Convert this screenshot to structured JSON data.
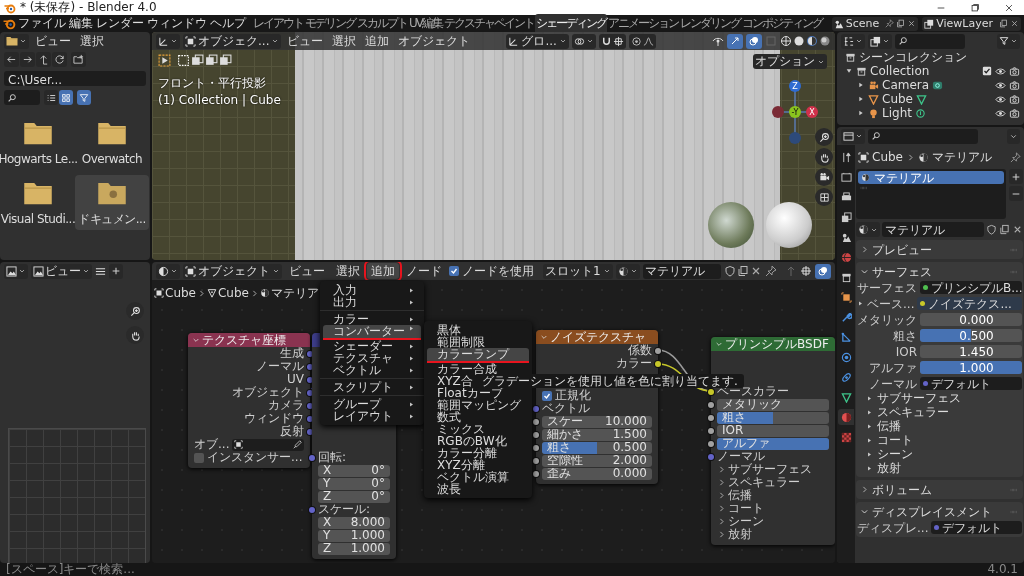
{
  "window": {
    "title": "* (未保存) - Blender 4.0"
  },
  "menu_bar": [
    "ファイル",
    "編集",
    "レンダー",
    "ウィンドウ",
    "ヘルプ"
  ],
  "workspace_tabs": [
    {
      "label": "レイアウト",
      "selected": false
    },
    {
      "label": "モデリング",
      "selected": false
    },
    {
      "label": "スカルプト",
      "selected": false
    },
    {
      "label": "UV編集",
      "selected": false
    },
    {
      "label": "テクスチャペイント",
      "selected": false
    },
    {
      "label": "シェーディング",
      "selected": true
    },
    {
      "label": "アニメーション",
      "selected": false
    },
    {
      "label": "レンダリング",
      "selected": false
    },
    {
      "label": "コンポジティング",
      "selected": false
    }
  ],
  "scene": "Scene",
  "view_layer": "ViewLayer",
  "file_browser": {
    "menu": [
      "ビュー",
      "選択"
    ],
    "path": "C:\\User...",
    "items": [
      {
        "name": "Hogwarts Le...",
        "selected": false
      },
      {
        "name": "Overwatch",
        "selected": false
      },
      {
        "name": "Visual Studi...",
        "selected": false
      },
      {
        "name": "ドキュメン...",
        "selected": true
      }
    ]
  },
  "viewport": {
    "mode": "オブジェク...",
    "menu": [
      "ビュー",
      "選択",
      "追加",
      "オブジェクト"
    ],
    "orientation": "グロ...",
    "options": "オプション",
    "view_name": "フロント・平行投影",
    "info": "(1) Collection | Cube",
    "gizmo": {
      "z": "Z",
      "y": "-Y",
      "x": "X"
    }
  },
  "image_editor": {
    "view": "ビュー"
  },
  "node_editor": {
    "mode": "オブジェクト",
    "menu": [
      {
        "label": "ビュー",
        "selected": false,
        "annotated": false
      },
      {
        "label": "選択",
        "selected": false,
        "annotated": false
      },
      {
        "label": "追加",
        "selected": true,
        "annotated": true
      },
      {
        "label": "ノード",
        "selected": false,
        "annotated": false
      }
    ],
    "use_nodes": {
      "label": "ノードを使用",
      "checked": true
    },
    "slot": "スロット1",
    "material": "マテリアル",
    "breadcrumb": [
      "Cube",
      "Cube",
      "マテリア"
    ],
    "nodes": [
      {
        "title": "テクスチャ座標",
        "color": "#8a3350",
        "rows": [
          {
            "kind": "output",
            "label": "生成",
            "color": "#6363c7"
          },
          {
            "kind": "output",
            "label": "ノーマル",
            "color": "#6363c7"
          },
          {
            "kind": "output",
            "label": "UV",
            "color": "#6363c7"
          },
          {
            "kind": "output",
            "label": "オブジェクト",
            "color": "#6363c7"
          },
          {
            "kind": "output",
            "label": "カメラ",
            "color": "#6363c7"
          },
          {
            "kind": "output",
            "label": "ウィンドウ",
            "color": "#6363c7"
          },
          {
            "kind": "output",
            "label": "反射",
            "color": "#6363c7"
          },
          {
            "kind": "object",
            "label": "オブ..."
          },
          {
            "kind": "checkbox",
            "label": "インスタンサー...",
            "checked": false
          }
        ]
      },
      {
        "color": "#3d3d8a",
        "rows": [
          {
            "kind": "input",
            "label": "回転:",
            "color": "#6363c7"
          },
          {
            "kind": "field",
            "label": "X",
            "value": "0°"
          },
          {
            "kind": "field",
            "label": "Y",
            "value": "0°"
          },
          {
            "kind": "field",
            "label": "Z",
            "value": "0°"
          },
          {
            "kind": "input",
            "label": "スケール:",
            "color": "#6363c7"
          },
          {
            "kind": "field",
            "label": "X",
            "value": "8.000"
          },
          {
            "kind": "field",
            "label": "Y",
            "value": "1.000"
          },
          {
            "kind": "field",
            "label": "Z",
            "value": "1.000"
          }
        ]
      },
      {
        "title": "ノイズテクスチャ",
        "color": "#8a4d1f",
        "rows": [
          {
            "kind": "output",
            "label": "係数",
            "color": "#a1a1a1"
          },
          {
            "kind": "output",
            "label": "カラー",
            "color": "#c7c729"
          },
          {
            "kind": "checkbox",
            "label": "正規化",
            "checked": true
          },
          {
            "kind": "input",
            "label": "ベクトル",
            "color": "#6363c7"
          },
          {
            "kind": "field",
            "label": "スケー",
            "value": "10.000",
            "color": "#a1a1a1"
          },
          {
            "kind": "field",
            "label": "細かさ",
            "value": "1.500",
            "color": "#a1a1a1"
          },
          {
            "kind": "field",
            "label": "粗さ",
            "value": "0.500",
            "level": 0.5,
            "color": "#a1a1a1"
          },
          {
            "kind": "field",
            "label": "空隙性",
            "value": "2.000",
            "color": "#a1a1a1"
          },
          {
            "kind": "field",
            "label": "歪み",
            "value": "0.000",
            "color": "#a1a1a1"
          }
        ]
      },
      {
        "title": "プリンシプルBSDF",
        "color": "#2e6b35",
        "rows": [
          {
            "kind": "input",
            "label": "ベースカラー",
            "color": "#c7c729"
          },
          {
            "kind": "field",
            "label": "メタリック",
            "color": "#a1a1a1"
          },
          {
            "kind": "field",
            "label": "粗さ",
            "level": 0.5,
            "color": "#a1a1a1"
          },
          {
            "kind": "field",
            "label": "IOR",
            "color": "#a1a1a1"
          },
          {
            "kind": "field",
            "label": "アルファ",
            "level": 1,
            "color": "#a1a1a1"
          },
          {
            "kind": "input",
            "label": "ノーマル",
            "color": "#6363c7"
          },
          {
            "kind": "panel",
            "label": "サブサーフェス"
          },
          {
            "kind": "panel",
            "label": "スペキュラー"
          },
          {
            "kind": "panel",
            "label": "伝播"
          },
          {
            "kind": "panel",
            "label": "コート"
          },
          {
            "kind": "panel",
            "label": "シーン"
          },
          {
            "kind": "panel",
            "label": "放射"
          }
        ]
      }
    ],
    "add_menu": [
      [
        {
          "label": "入力",
          "selected": false,
          "annotated": false
        },
        {
          "label": "出力",
          "selected": false,
          "annotated": false
        }
      ],
      [
        {
          "label": "カラー",
          "selected": false,
          "annotated": false
        },
        {
          "label": "コンバーター",
          "selected": true,
          "annotated": true
        },
        {
          "label": "シェーダー",
          "selected": false,
          "annotated": false
        },
        {
          "label": "テクスチャ",
          "selected": false,
          "annotated": false
        },
        {
          "label": "ベクトル",
          "selected": false,
          "annotated": false
        }
      ],
      [
        {
          "label": "スクリプト",
          "selected": false,
          "annotated": false
        }
      ],
      [
        {
          "label": "グループ",
          "selected": false,
          "annotated": false
        },
        {
          "label": "レイアウト",
          "selected": false,
          "annotated": false
        }
      ]
    ],
    "converter_menu": [
      {
        "label": "黒体",
        "selected": false,
        "annotated": false
      },
      {
        "label": "範囲制限",
        "selected": false,
        "annotated": false
      },
      {
        "label": "カラーランプ",
        "selected": true,
        "annotated": true
      },
      {
        "label": "カラー合成",
        "selected": false,
        "annotated": false
      },
      {
        "label": "XYZ合",
        "selected": false,
        "annotated": false
      },
      {
        "label": "Floatカーブ",
        "selected": false,
        "annotated": false
      },
      {
        "label": "範囲マッピング",
        "selected": false,
        "annotated": false
      },
      {
        "label": "数式",
        "selected": false,
        "annotated": false
      },
      {
        "label": "ミックス",
        "selected": false,
        "annotated": false
      },
      {
        "label": "RGBのBW化",
        "selected": false,
        "annotated": false
      },
      {
        "label": "カラー分離",
        "selected": false,
        "annotated": false
      },
      {
        "label": "XYZ分離",
        "selected": false,
        "annotated": false
      },
      {
        "label": "ベクトル演算",
        "selected": false,
        "annotated": false
      },
      {
        "label": "波長",
        "selected": false,
        "annotated": false
      }
    ],
    "tooltip": "グラデーションを使用し値を色に割り当てます."
  },
  "outliner": {
    "root": "シーンコレクション",
    "items": [
      {
        "name": "Collection",
        "kind": "collection",
        "expanded": true,
        "checked": true,
        "children": [
          {
            "name": "Camera",
            "kind": "camera",
            "expanded": false
          },
          {
            "name": "Cube",
            "kind": "mesh",
            "expanded": false
          },
          {
            "name": "Light",
            "kind": "light",
            "expanded": false
          }
        ]
      }
    ]
  },
  "properties": {
    "tabs": [
      {
        "selected": false
      },
      {
        "selected": false
      },
      {
        "selected": false
      },
      {
        "selected": false
      },
      {
        "selected": false
      },
      {
        "selected": false
      },
      {
        "selected": false
      },
      {
        "selected": false
      },
      {
        "selected": false
      },
      {
        "selected": false
      },
      {
        "selected": false
      },
      {
        "selected": false
      },
      {
        "selected": false
      },
      {
        "selected": true
      },
      {
        "selected": false
      }
    ],
    "breadcrumb": [
      "Cube",
      "マテリアル"
    ],
    "slots": [
      {
        "name": "マテリアル",
        "selected": true
      }
    ],
    "material": "マテリアル",
    "sections": [
      {
        "title": "プレビュー",
        "expanded": false
      },
      {
        "title": "サーフェス",
        "expanded": true,
        "rows": [
          {
            "kind": "link",
            "label": "サーフェス",
            "value": "プリンシプルB...",
            "color": "#4fbf4f"
          },
          {
            "kind": "linked",
            "label": "ベース...",
            "value": "ノイズテクス...",
            "color": "#c7c729"
          },
          {
            "kind": "number",
            "label": "メタリック",
            "value": "0.000"
          },
          {
            "kind": "number",
            "label": "粗さ",
            "value": "0.500",
            "level": 0.5
          },
          {
            "kind": "number",
            "label": "IOR",
            "value": "1.450"
          },
          {
            "kind": "number",
            "label": "アルファ",
            "value": "1.000",
            "level": 1
          },
          {
            "kind": "link",
            "label": "ノーマル",
            "value": "デフォルト",
            "color": "#6363c7"
          },
          {
            "kind": "sub",
            "label": "サブサーフェス"
          },
          {
            "kind": "sub",
            "label": "スペキュラー"
          },
          {
            "kind": "sub",
            "label": "伝播"
          },
          {
            "kind": "sub",
            "label": "コート"
          },
          {
            "kind": "sub",
            "label": "シーン"
          },
          {
            "kind": "sub",
            "label": "放射"
          }
        ]
      },
      {
        "title": "ボリューム",
        "expanded": false
      },
      {
        "title": "ディスプレイスメント",
        "expanded": true,
        "rows": [
          {
            "kind": "link",
            "label": "ディスプレ...",
            "value": "デフォルト",
            "color": "#6363c7"
          }
        ]
      }
    ]
  },
  "status_bar": {
    "hint": "[スペース]キーで検索...",
    "version": "4.0.1"
  }
}
